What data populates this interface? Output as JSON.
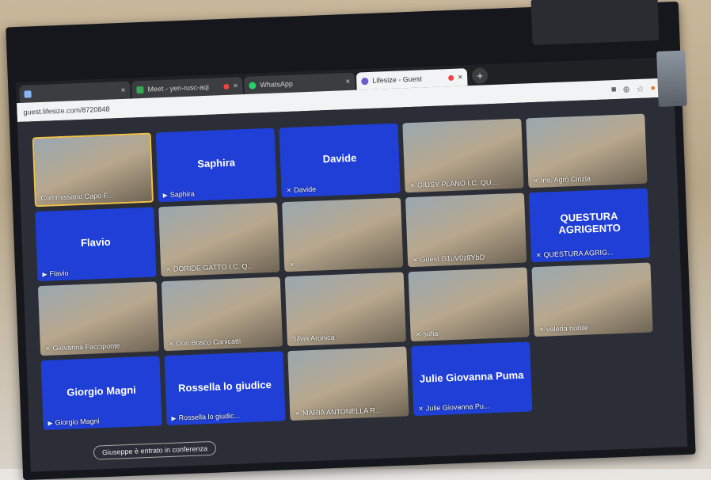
{
  "browser": {
    "tabs": [
      {
        "label": "",
        "color": "#8ab4f8"
      },
      {
        "label": "Meet - yen-rusc-aqi",
        "color": "#34a853"
      },
      {
        "label": "WhatsApp",
        "color": "#25d366"
      },
      {
        "label": "Lifesize - Guest",
        "color": "#6a5acd"
      }
    ],
    "address": "guest.lifesize.com/8720848"
  },
  "participants": [
    {
      "name": "Commissario Capo F...",
      "kind": "video",
      "speaking": true
    },
    {
      "name": "Saphira",
      "display": "Saphira",
      "kind": "avatar"
    },
    {
      "name": "Davide",
      "display": "Davide",
      "kind": "avatar"
    },
    {
      "name": "GIUSY PLANO I.C. QU...",
      "kind": "video"
    },
    {
      "name": "Ins. Agrò Cinzia",
      "kind": "video"
    },
    {
      "name": "Flavio",
      "display": "Flavio",
      "kind": "avatar"
    },
    {
      "name": "DORIDE GATTO I.C. Q...",
      "kind": "video"
    },
    {
      "name": "...",
      "kind": "video"
    },
    {
      "name": "Guest G1uV0z8YbD",
      "kind": "video"
    },
    {
      "name": "QUESTURA AGRIG...",
      "display": "QUESTURA AGRIGENTO",
      "kind": "avatar"
    },
    {
      "name": "Giovanna Facciponte",
      "kind": "video"
    },
    {
      "name": "Don Bosco Canicatti",
      "kind": "video"
    },
    {
      "name": "Silvia Aronica",
      "kind": "video"
    },
    {
      "name": "sofia",
      "kind": "video"
    },
    {
      "name": "valeria nobile",
      "kind": "video"
    },
    {
      "name": "Giorgio Magni",
      "display": "Giorgio Magni",
      "kind": "avatar"
    },
    {
      "name": "Rossella lo giudic...",
      "display": "Rossella lo giudice",
      "kind": "avatar"
    },
    {
      "name": "MARIA ANTONELLA R...",
      "kind": "video"
    },
    {
      "name": "Julie Giovanna Pu...",
      "display": "Julie Giovanna Puma",
      "kind": "avatar"
    }
  ],
  "notification": "Giuseppe è entrato in conferenza",
  "colors": {
    "tile_blue": "#1f3fd6",
    "active_border": "#f2c14a"
  }
}
